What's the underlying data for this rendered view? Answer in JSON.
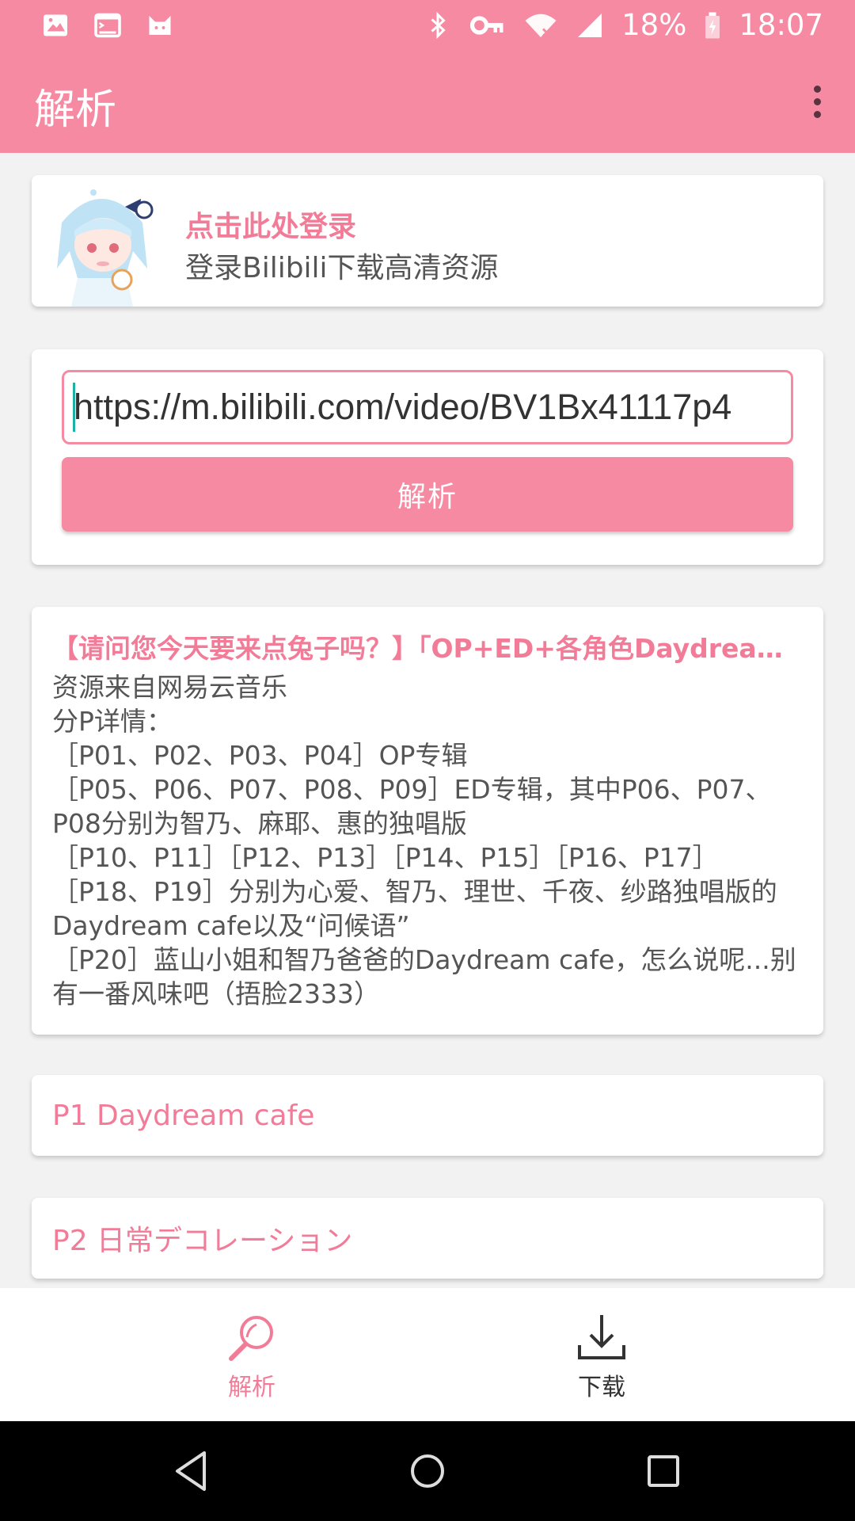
{
  "status_bar": {
    "icons_left": [
      "image-icon",
      "terminal-icon",
      "cat-icon"
    ],
    "icons_right": [
      "bluetooth-icon",
      "vpn-key-icon",
      "wifi-icon",
      "signal-icon"
    ],
    "battery": "18%",
    "time": "18:07"
  },
  "toolbar": {
    "title": "解析",
    "menu_icon": "more-vert-icon"
  },
  "login": {
    "title": "点击此处登录",
    "subtitle": "登录Bilibili下载高清资源"
  },
  "parse": {
    "url_value": "https://m.bilibili.com/video/BV1Bx41117p4",
    "button_label": "解析"
  },
  "video_info": {
    "title": "【请问您今天要来点兔子吗？】「OP+ED+各角色Daydream cafe」",
    "description": "资源来自网易云音乐\n分P详情：\n［P01、P02、P03、P04］OP专辑\n［P05、P06、P07、P08、P09］ED专辑，其中P06、P07、P08分别为智乃、麻耶、惠的独唱版\n［P10、P11］［P12、P13］［P14、P15］［P16、P17］［P18、P19］分别为心爱、智乃、理世、千夜、纱路独唱版的Daydream cafe以及“问候语”\n［P20］蓝山小姐和智乃爸爸的Daydream cafe，怎么说呢...别有一番风味吧（捂脸2333）"
  },
  "parts": [
    {
      "label": "P1 Daydream cafe"
    },
    {
      "label": "P2 日常デコレーション"
    }
  ],
  "bottom_nav": {
    "items": [
      {
        "label": "解析",
        "icon": "search-icon",
        "active": true
      },
      {
        "label": "下载",
        "icon": "download-icon",
        "active": false
      }
    ]
  },
  "system_nav": [
    "back-icon",
    "home-icon",
    "recents-icon"
  ],
  "colors": {
    "accent": "#f68aa2",
    "accent_text": "#f27c98",
    "cursor": "#1bb1a6"
  }
}
